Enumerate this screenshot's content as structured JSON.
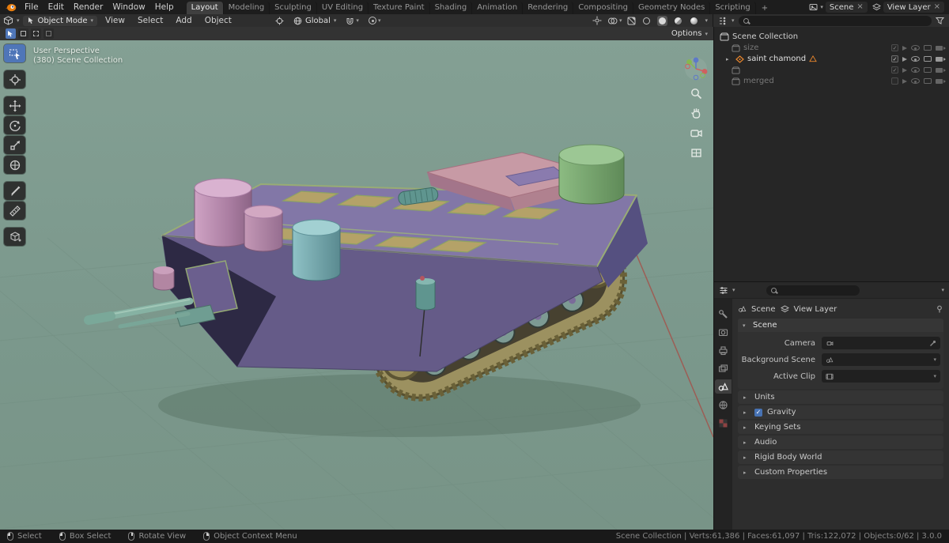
{
  "colors": {
    "accent": "#4772b3",
    "viewport_bg": "#7f9c90",
    "selection_orange": "#e8862d",
    "axis_x_red": "#a3544c"
  },
  "icons": {
    "caret": "▾",
    "disclosure_open": "▾",
    "disclosure_closed": "▸",
    "close": "×",
    "check": "✓"
  },
  "topbar": {
    "menus": [
      "File",
      "Edit",
      "Render",
      "Window",
      "Help"
    ],
    "tabs": [
      "Layout",
      "Modeling",
      "Sculpting",
      "UV Editing",
      "Texture Paint",
      "Shading",
      "Animation",
      "Rendering",
      "Compositing",
      "Geometry Nodes",
      "Scripting"
    ],
    "active_tab": "Layout",
    "add_tab_label": "+",
    "scene_selector": "Scene",
    "view_layer_selector": "View Layer"
  },
  "viewport_header": {
    "mode": "Object Mode",
    "menus": [
      "View",
      "Select",
      "Add",
      "Object"
    ],
    "orientation": "Global",
    "options_label": "Options"
  },
  "viewport": {
    "overlay_line1": "User Perspective",
    "overlay_line2": "(380) Scene Collection"
  },
  "outliner": {
    "rows": [
      {
        "label": "Scene Collection"
      },
      {
        "label": "size"
      },
      {
        "label": "saint chamond"
      },
      {
        "label": ""
      },
      {
        "label": "merged"
      }
    ]
  },
  "properties": {
    "breadcrumb": [
      "Scene",
      "View Layer"
    ],
    "panels": {
      "scene_header": "Scene",
      "fields": [
        "Camera",
        "Background Scene",
        "Active Clip"
      ],
      "collapsed": [
        "Units",
        "Gravity",
        "Keying Sets",
        "Audio",
        "Rigid Body World",
        "Custom Properties"
      ],
      "gravity_checked": true
    }
  },
  "statusbar": {
    "hints": [
      "Select",
      "Box Select",
      "Rotate View",
      "Object Context Menu"
    ],
    "stats": "Scene Collection | Verts:61,386 | Faces:61,097 | Tris:122,072 | Objects:0/62 | 3.0.0"
  }
}
